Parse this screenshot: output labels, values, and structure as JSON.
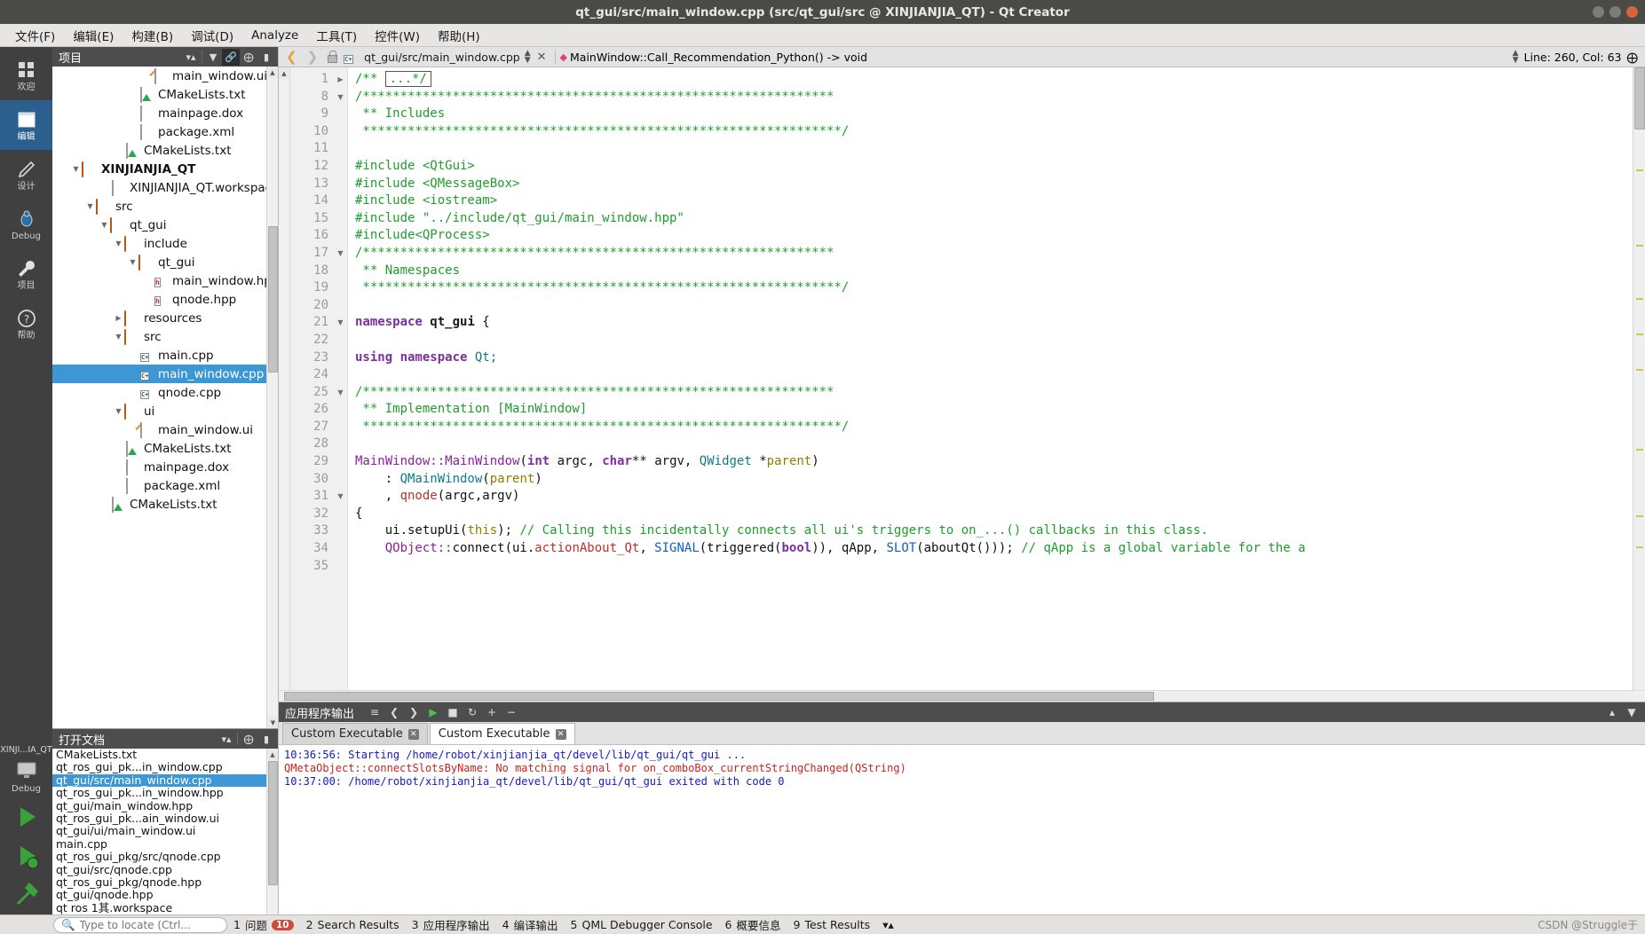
{
  "window": {
    "title": "qt_gui/src/main_window.cpp (src/qt_gui/src @ XINJIANJIA_QT) - Qt Creator",
    "min_label": "minimize-button",
    "max_label": "maximize-button",
    "close_label": "close-button"
  },
  "menubar": [
    {
      "label": "文件(F)",
      "key": "F"
    },
    {
      "label": "编辑(E)",
      "key": "E"
    },
    {
      "label": "构建(B)",
      "key": "B"
    },
    {
      "label": "调试(D)",
      "key": "D"
    },
    {
      "label": "Analyze",
      "key": "A"
    },
    {
      "label": "工具(T)",
      "key": "T"
    },
    {
      "label": "控件(W)",
      "key": "W"
    },
    {
      "label": "帮助(H)",
      "key": "H"
    }
  ],
  "modebar": [
    {
      "id": "welcome",
      "label": "欢迎",
      "icon": "grid-icon",
      "active": false
    },
    {
      "id": "edit",
      "label": "编辑",
      "icon": "edit-icon",
      "active": true
    },
    {
      "id": "design",
      "label": "设计",
      "icon": "design-icon",
      "active": false
    },
    {
      "id": "debug",
      "label": "Debug",
      "icon": "bug-icon",
      "active": false
    },
    {
      "id": "projects",
      "label": "项目",
      "icon": "wrench-icon",
      "active": false
    },
    {
      "id": "help",
      "label": "帮助",
      "icon": "help-icon",
      "active": false
    }
  ],
  "modebar_bottom": {
    "kit_label": "XINJI...IA_QT",
    "build_label": "Debug",
    "run_icon": "run-triangle-icon",
    "debug_icon": "run-debug-icon",
    "build_icon": "hammer-icon"
  },
  "projects_panel": {
    "title": "项目",
    "buttons": [
      "sort-icon",
      "filter-icon",
      "link-icon",
      "split-icon",
      "hide-icon"
    ],
    "tree": [
      {
        "label": "main_window.ui",
        "indent": 6,
        "icon": "ui-file-icon",
        "arrow": "",
        "selected": false,
        "bold": false
      },
      {
        "label": "CMakeLists.txt",
        "indent": 5,
        "icon": "cmake-file-icon",
        "arrow": "",
        "selected": false,
        "bold": false
      },
      {
        "label": "mainpage.dox",
        "indent": 5,
        "icon": "doc-file-icon",
        "arrow": "",
        "selected": false,
        "bold": false
      },
      {
        "label": "package.xml",
        "indent": 5,
        "icon": "doc-file-icon",
        "arrow": "",
        "selected": false,
        "bold": false
      },
      {
        "label": "CMakeLists.txt",
        "indent": 4,
        "icon": "cmake-file-icon",
        "arrow": "",
        "selected": false,
        "bold": false
      },
      {
        "label": "XINJIANJIA_QT",
        "indent": 1,
        "icon": "folder-icon",
        "arrow": "down",
        "selected": false,
        "bold": true
      },
      {
        "label": "XINJIANJIA_QT.workspace",
        "indent": 3,
        "icon": "doc-file-icon",
        "arrow": "",
        "selected": false,
        "bold": false
      },
      {
        "label": "src",
        "indent": 2,
        "icon": "folder-icon",
        "arrow": "down",
        "selected": false,
        "bold": false
      },
      {
        "label": "qt_gui",
        "indent": 3,
        "icon": "folder-icon",
        "arrow": "down",
        "selected": false,
        "bold": false
      },
      {
        "label": "include",
        "indent": 4,
        "icon": "folder-icon",
        "arrow": "down",
        "selected": false,
        "bold": false
      },
      {
        "label": "qt_gui",
        "indent": 5,
        "icon": "folder-icon",
        "arrow": "down",
        "selected": false,
        "bold": false
      },
      {
        "label": "main_window.hpp",
        "indent": 6,
        "icon": "h-file-icon",
        "arrow": "",
        "selected": false,
        "bold": false
      },
      {
        "label": "qnode.hpp",
        "indent": 6,
        "icon": "h-file-icon",
        "arrow": "",
        "selected": false,
        "bold": false
      },
      {
        "label": "resources",
        "indent": 4,
        "icon": "folder-icon",
        "arrow": "right",
        "selected": false,
        "bold": false
      },
      {
        "label": "src",
        "indent": 4,
        "icon": "folder-icon",
        "arrow": "down",
        "selected": false,
        "bold": false
      },
      {
        "label": "main.cpp",
        "indent": 5,
        "icon": "cpp-file-icon",
        "arrow": "",
        "selected": false,
        "bold": false
      },
      {
        "label": "main_window.cpp",
        "indent": 5,
        "icon": "cpp-file-icon",
        "arrow": "",
        "selected": true,
        "bold": false
      },
      {
        "label": "qnode.cpp",
        "indent": 5,
        "icon": "cpp-file-icon",
        "arrow": "",
        "selected": false,
        "bold": false
      },
      {
        "label": "ui",
        "indent": 4,
        "icon": "folder-icon",
        "arrow": "down",
        "selected": false,
        "bold": false
      },
      {
        "label": "main_window.ui",
        "indent": 5,
        "icon": "ui-file-icon",
        "arrow": "",
        "selected": false,
        "bold": false
      },
      {
        "label": "CMakeLists.txt",
        "indent": 4,
        "icon": "cmake-file-icon",
        "arrow": "",
        "selected": false,
        "bold": false
      },
      {
        "label": "mainpage.dox",
        "indent": 4,
        "icon": "doc-file-icon",
        "arrow": "",
        "selected": false,
        "bold": false
      },
      {
        "label": "package.xml",
        "indent": 4,
        "icon": "doc-file-icon",
        "arrow": "",
        "selected": false,
        "bold": false
      },
      {
        "label": "CMakeLists.txt",
        "indent": 3,
        "icon": "cmake-file-icon",
        "arrow": "",
        "selected": false,
        "bold": false
      }
    ]
  },
  "open_documents": {
    "title": "打开文档",
    "buttons": [
      "sort-icon",
      "split-icon",
      "hide-icon"
    ],
    "items": [
      {
        "label": "CMakeLists.txt",
        "selected": false
      },
      {
        "label": "qt_ros_gui_pk...in_window.cpp",
        "selected": false
      },
      {
        "label": "qt_gui/src/main_window.cpp",
        "selected": true
      },
      {
        "label": "qt_ros_gui_pk...in_window.hpp",
        "selected": false
      },
      {
        "label": "qt_gui/main_window.hpp",
        "selected": false
      },
      {
        "label": "qt_ros_gui_pk...ain_window.ui",
        "selected": false
      },
      {
        "label": "qt_gui/ui/main_window.ui",
        "selected": false
      },
      {
        "label": "main.cpp",
        "selected": false
      },
      {
        "label": "qt_ros_gui_pkg/src/qnode.cpp",
        "selected": false
      },
      {
        "label": "qt_gui/src/qnode.cpp",
        "selected": false
      },
      {
        "label": "qt_ros_gui_pkg/qnode.hpp",
        "selected": false
      },
      {
        "label": "qt_gui/qnode.hpp",
        "selected": false
      },
      {
        "label": "qt ros 1其.workspace",
        "selected": false
      }
    ]
  },
  "editor_toolbar": {
    "back_icon": "back-arrow-icon",
    "forward_icon": "forward-arrow-icon",
    "lock_icon": "unlock-icon",
    "file_icon": "cpp-file-icon",
    "file_name": "qt_gui/src/main_window.cpp",
    "close_icon": "close-icon",
    "symbol_icon": "function-symbol-icon",
    "symbol_name": "MainWindow::Call_Recommendation_Python() -> void",
    "cursor_position": "Line: 260, Col: 63",
    "split_icon": "split-editor-icon"
  },
  "code": {
    "lines": [
      {
        "num": "1",
        "fold": "right",
        "segs": [
          {
            "t": "/** ",
            "c": "k-com"
          },
          {
            "t": "...*/",
            "c": "k-com foldbox"
          }
        ]
      },
      {
        "num": "8",
        "fold": "down",
        "segs": [
          {
            "t": "/***************************************************************",
            "c": "k-com"
          }
        ]
      },
      {
        "num": "9",
        "fold": "",
        "segs": [
          {
            "t": " ** Includes",
            "c": "k-com"
          }
        ]
      },
      {
        "num": "10",
        "fold": "",
        "segs": [
          {
            "t": " ****************************************************************/",
            "c": "k-com"
          }
        ]
      },
      {
        "num": "11",
        "fold": "",
        "segs": []
      },
      {
        "num": "12",
        "fold": "",
        "segs": [
          {
            "t": "#include ",
            "c": "k-pp"
          },
          {
            "t": "<QtGui>",
            "c": "k-str"
          }
        ]
      },
      {
        "num": "13",
        "fold": "",
        "segs": [
          {
            "t": "#include ",
            "c": "k-pp"
          },
          {
            "t": "<QMessageBox>",
            "c": "k-str"
          }
        ]
      },
      {
        "num": "14",
        "fold": "",
        "segs": [
          {
            "t": "#include ",
            "c": "k-pp"
          },
          {
            "t": "<iostream>",
            "c": "k-str"
          }
        ]
      },
      {
        "num": "15",
        "fold": "",
        "segs": [
          {
            "t": "#include ",
            "c": "k-pp"
          },
          {
            "t": "\"../include/qt_gui/main_window.hpp\"",
            "c": "k-str"
          }
        ]
      },
      {
        "num": "16",
        "fold": "",
        "segs": [
          {
            "t": "#include",
            "c": "k-pp"
          },
          {
            "t": "<QProcess>",
            "c": "k-str"
          }
        ]
      },
      {
        "num": "17",
        "fold": "down",
        "segs": [
          {
            "t": "/***************************************************************",
            "c": "k-com"
          }
        ]
      },
      {
        "num": "18",
        "fold": "",
        "segs": [
          {
            "t": " ** Namespaces",
            "c": "k-com"
          }
        ]
      },
      {
        "num": "19",
        "fold": "",
        "segs": [
          {
            "t": " ****************************************************************/",
            "c": "k-com"
          }
        ]
      },
      {
        "num": "20",
        "fold": "",
        "segs": []
      },
      {
        "num": "21",
        "fold": "down",
        "segs": [
          {
            "t": "namespace ",
            "c": "k-kw"
          },
          {
            "t": "qt_gui",
            "c": "k-fn"
          },
          {
            "t": " {",
            "c": ""
          }
        ]
      },
      {
        "num": "22",
        "fold": "",
        "segs": []
      },
      {
        "num": "23",
        "fold": "",
        "segs": [
          {
            "t": "using namespace ",
            "c": "k-kw"
          },
          {
            "t": "Qt;",
            "c": "k-teal"
          }
        ]
      },
      {
        "num": "24",
        "fold": "",
        "segs": []
      },
      {
        "num": "25",
        "fold": "down",
        "segs": [
          {
            "t": "/***************************************************************",
            "c": "k-com"
          }
        ]
      },
      {
        "num": "26",
        "fold": "",
        "segs": [
          {
            "t": " ** Implementation [MainWindow]",
            "c": "k-com"
          }
        ]
      },
      {
        "num": "27",
        "fold": "",
        "segs": [
          {
            "t": " ****************************************************************/",
            "c": "k-com"
          }
        ]
      },
      {
        "num": "28",
        "fold": "",
        "segs": []
      },
      {
        "num": "29",
        "fold": "",
        "segs": [
          {
            "t": "MainWindow::",
            "c": "k-purple"
          },
          {
            "t": "MainWindow",
            "c": "k-purple"
          },
          {
            "t": "(",
            "c": ""
          },
          {
            "t": "int",
            "c": "k-kw"
          },
          {
            "t": " argc, ",
            "c": ""
          },
          {
            "t": "char",
            "c": "k-kw"
          },
          {
            "t": "** argv, ",
            "c": ""
          },
          {
            "t": "QWidget",
            "c": "k-teal"
          },
          {
            "t": " *",
            "c": ""
          },
          {
            "t": "parent",
            "c": "k-olive"
          },
          {
            "t": ")",
            "c": ""
          }
        ]
      },
      {
        "num": "30",
        "fold": "",
        "segs": [
          {
            "t": "    : ",
            "c": ""
          },
          {
            "t": "QMainWindow",
            "c": "k-teal"
          },
          {
            "t": "(",
            "c": ""
          },
          {
            "t": "parent",
            "c": "k-olive"
          },
          {
            "t": ")",
            "c": ""
          }
        ]
      },
      {
        "num": "31",
        "fold": "down",
        "segs": [
          {
            "t": "    , ",
            "c": ""
          },
          {
            "t": "qnode",
            "c": "k-red"
          },
          {
            "t": "(argc,argv)",
            "c": ""
          }
        ]
      },
      {
        "num": "32",
        "fold": "",
        "segs": [
          {
            "t": "{",
            "c": ""
          }
        ]
      },
      {
        "num": "33",
        "fold": "",
        "segs": [
          {
            "t": "    ui.setupUi(",
            "c": ""
          },
          {
            "t": "this",
            "c": "k-olive"
          },
          {
            "t": "); ",
            "c": ""
          },
          {
            "t": "// Calling this incidentally connects all ui's triggers to on_...() callbacks in this class.",
            "c": "k-com"
          }
        ]
      },
      {
        "num": "34",
        "fold": "",
        "segs": [
          {
            "t": "    QObject::",
            "c": "k-purple"
          },
          {
            "t": "connect(ui.",
            "c": ""
          },
          {
            "t": "actionAbout_Qt",
            "c": "k-red"
          },
          {
            "t": ", ",
            "c": ""
          },
          {
            "t": "SIGNAL",
            "c": "k-blue"
          },
          {
            "t": "(triggered(",
            "c": ""
          },
          {
            "t": "bool",
            "c": "k-kw"
          },
          {
            "t": ")), qApp, ",
            "c": ""
          },
          {
            "t": "SLOT",
            "c": "k-blue"
          },
          {
            "t": "(aboutQt())); ",
            "c": ""
          },
          {
            "t": "// qApp is a global variable for the a",
            "c": "k-com"
          }
        ]
      },
      {
        "num": "35",
        "fold": "",
        "segs": []
      }
    ]
  },
  "output_pane": {
    "title": "应用程序输出",
    "toolbar_icons": [
      "filter-icon",
      "prev-icon",
      "next-icon",
      "run-icon",
      "stop-icon",
      "rerun-icon",
      "zoom-in-icon",
      "zoom-out-icon"
    ],
    "right_icons": [
      "maximize-pane-icon",
      "close-pane-icon"
    ],
    "tabs": [
      {
        "label": "Custom Executable",
        "active": false,
        "close_icon": "close-icon"
      },
      {
        "label": "Custom Executable",
        "active": true,
        "close_icon": "close-icon"
      }
    ],
    "lines": [
      {
        "text": "10:36:56: Starting /home/robot/xinjianjia_qt/devel/lib/qt_gui/qt_gui ...",
        "color": "o-blue"
      },
      {
        "text": "QMetaObject::connectSlotsByName: No matching signal for on_comboBox_currentStringChanged(QString)",
        "color": "o-red"
      },
      {
        "text": "10:37:00: /home/robot/xinjianjia_qt/devel/lib/qt_gui/qt_gui exited with code 0",
        "color": "o-blue"
      }
    ]
  },
  "statusbar": {
    "search_placeholder": "Type to locate (Ctrl...",
    "search_icon": "search-icon",
    "items": [
      {
        "num": "1",
        "label": "问题",
        "badge": "10"
      },
      {
        "num": "2",
        "label": "Search Results",
        "badge": ""
      },
      {
        "num": "3",
        "label": "应用程序输出",
        "badge": ""
      },
      {
        "num": "4",
        "label": "编译输出",
        "badge": ""
      },
      {
        "num": "5",
        "label": "QML Debugger Console",
        "badge": ""
      },
      {
        "num": "6",
        "label": "概要信息",
        "badge": ""
      },
      {
        "num": "9",
        "label": "Test Results",
        "badge": ""
      }
    ],
    "more_icon": "more-icon",
    "watermark": "CSDN @Struggle于"
  },
  "colors": {
    "accent": "#3d97d4",
    "titlebar": "#4a4a46",
    "panel_header": "#4d4d4d",
    "comment_green": "#1f9d2c",
    "error_red": "#cc2222",
    "info_blue": "#1717c8"
  }
}
